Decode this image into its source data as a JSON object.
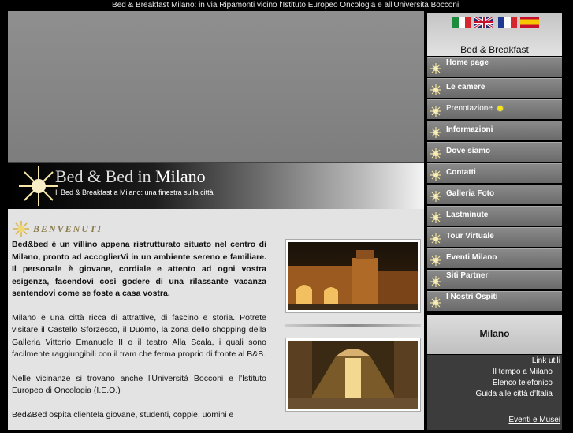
{
  "top_bar": {
    "text": "Bed & Breakfast Milano: in via Ripamonti vicino l'Istituto Europeo Oncologia e all'Università Bocconi."
  },
  "banner": {
    "title_part1": "Bed & Bed in ",
    "title_part2": "Milano",
    "subtitle": "Il Bed & Breakfast a Milano: una finestra sulla città"
  },
  "welcome": {
    "heading": "BENVENUTI"
  },
  "body": {
    "intro": "Bed&bed è un villino appena ristrutturato situato nel centro di Milano, pronto ad accoglierVi in un ambiente sereno e familiare. Il personale è giovane, cordiale e attento ad ogni vostra esigenza, facendovi così godere di una rilassante vacanza sentendovi come se foste a casa vostra.",
    "para2": "Milano è una città ricca di attrattive, di fascino e storia. Potrete visitare il Castello Sforzesco, il Duomo, la zona dello shopping della Galleria Vittorio Emanuele II o il teatro Alla Scala, i quali sono facilmente raggiungibili con il tram che ferma proprio di fronte al B&B.",
    "para3": "Nelle vicinanze si trovano anche l'Università Bocconi e l'Istituto Europeo di Oncologia (I.E.O.)",
    "para4": "Bed&Bed ospita clientela giovane, studenti, coppie, uomini e"
  },
  "sidebar": {
    "title": "Bed & Breakfast",
    "flags": [
      "italian-flag",
      "uk-flag",
      "french-flag",
      "spanish-flag"
    ],
    "menu": [
      "Home page",
      "Le camere",
      "Prenotazione",
      "Informazioni",
      "Dove siamo",
      "Contatti",
      "Galleria Foto",
      "Lastminute",
      "Tour Virtuale",
      "Eventi Milano",
      "Siti Partner",
      "I Nostri Ospiti"
    ],
    "city_box": "Milano",
    "links_heading": "Link utili",
    "links": [
      "Il tempo a Milano",
      "Elenco telefonico",
      "Guida alle città d'Italia"
    ],
    "links_heading2": "Eventi e Musei"
  },
  "colors": {
    "background": "#000000",
    "content_bg": "#e3e3e3",
    "menu_item": "#7a7a7a",
    "accent_gold": "#8a7a4a"
  }
}
